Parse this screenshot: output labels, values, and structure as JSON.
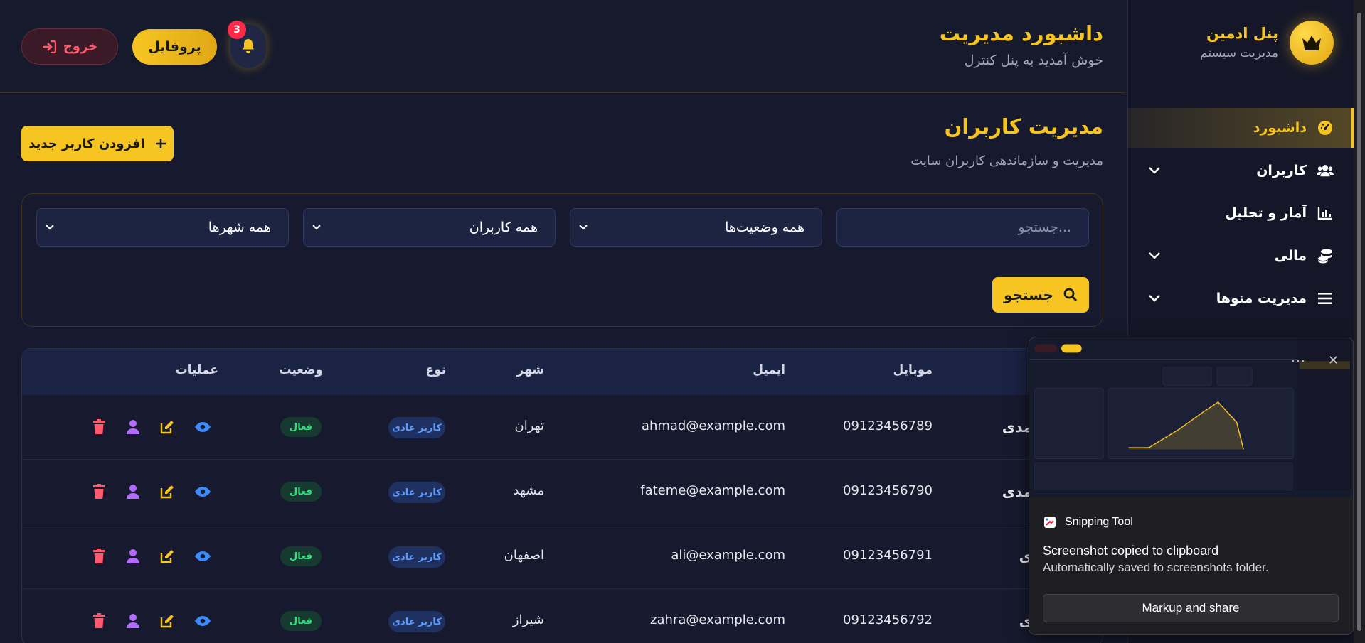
{
  "sidebar": {
    "brand_title": "پنل ادمین",
    "brand_subtitle": "مدیریت سیستم",
    "items": [
      {
        "label": "داشبورد",
        "icon": "gauge-icon",
        "active": true
      },
      {
        "label": "کاربران",
        "icon": "users-icon",
        "has_submenu": true
      },
      {
        "label": "آمار و تحلیل",
        "icon": "chart-icon"
      },
      {
        "label": "مالی",
        "icon": "coins-icon",
        "has_submenu": true
      },
      {
        "label": "مدیریت منوها",
        "icon": "menu-bars-icon",
        "has_submenu": true
      }
    ]
  },
  "header": {
    "title": "داشبورد مدیریت",
    "subtitle": "خوش آمدید به پنل کنترل",
    "notification_count": "3",
    "profile_label": "پروفایل",
    "logout_label": "خروج"
  },
  "section": {
    "title": "مدیریت کاربران",
    "subtitle": "مدیریت و سازماندهی کاربران سایت",
    "add_user_label": "افزودن کاربر جدید"
  },
  "filters": {
    "search_placeholder": "جستجو...",
    "status_selected": "همه وضعیت‌ها",
    "type_selected": "همه کاربران",
    "city_selected": "همه شهرها",
    "search_button": "جستجو"
  },
  "table": {
    "headers": {
      "mobile": "موبایل",
      "email": "ایمیل",
      "city": "شهر",
      "type": "نوع",
      "status": "وضعیت",
      "actions": "عملیات"
    },
    "rows": [
      {
        "name_tail": "مدی",
        "mobile": "09123456789",
        "email": "ahmad@example.com",
        "city": "تهران",
        "type": "کاربر عادی",
        "status": "فعال"
      },
      {
        "name_tail": "مدی",
        "mobile": "09123456790",
        "email": "fateme@example.com",
        "city": "مشهد",
        "type": "کاربر عادی",
        "status": "فعال"
      },
      {
        "name_tail": "ی",
        "mobile": "09123456791",
        "email": "ali@example.com",
        "city": "اصفهان",
        "type": "کاربر عادی",
        "status": "فعال"
      },
      {
        "name_tail": "ی",
        "mobile": "09123456792",
        "email": "zahra@example.com",
        "city": "شیراز",
        "type": "کاربر عادی",
        "status": "فعال"
      }
    ]
  },
  "snipping_tool": {
    "app_name": "Snipping Tool",
    "message": "Screenshot copied to clipboard",
    "detail": "Automatically saved to screenshots folder.",
    "button": "Markup and share",
    "more": "···",
    "close": "✕"
  },
  "colors": {
    "accent": "#f6c522",
    "background": "#171a2e",
    "danger": "#ff5a6e",
    "success": "#2ee07d",
    "info": "#5c9bff"
  }
}
